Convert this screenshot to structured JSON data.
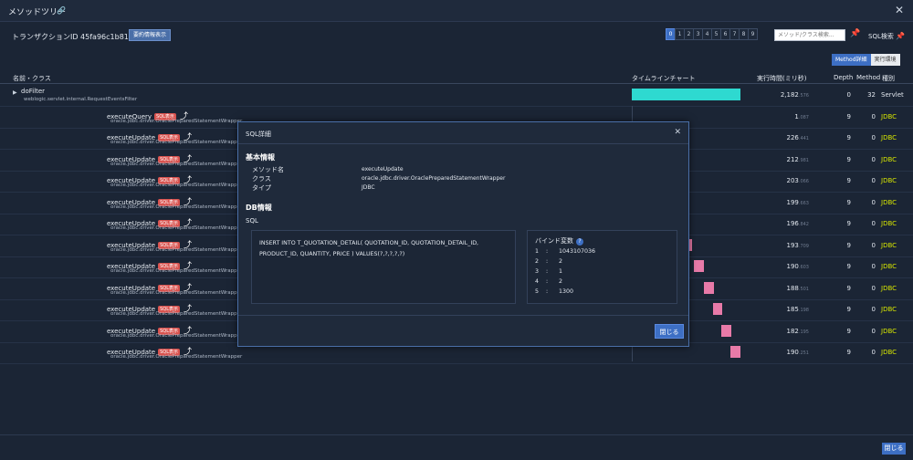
{
  "window": {
    "title": "メソッドツリー"
  },
  "transaction": {
    "label": "トランザクションID 45fa96c1b81c61ac",
    "summary_button": "要約情報表示"
  },
  "pager": [
    "0",
    "1",
    "2",
    "3",
    "4",
    "5",
    "6",
    "7",
    "8",
    "9"
  ],
  "search": {
    "placeholder": "メソッド/クラス検索..."
  },
  "sql_search_label": "SQL検索",
  "view_toggle": {
    "method_detail": "Method詳細",
    "exec_env": "実行環境"
  },
  "table": {
    "headers": {
      "name": "名前・クラス",
      "timeline": "タイムラインチャート",
      "time": "実行時間(ミリ秒)",
      "depth": "Depth",
      "method": "Method",
      "kind": "種別"
    }
  },
  "rows": [
    {
      "method": "doFilter",
      "class": "weblogic.servlet.internal.RequestEventsFilter",
      "time": "2,182",
      "time_frac": ".576",
      "depth": "0",
      "mcount": "32",
      "kind": "Servlet",
      "bar_start": 0.0,
      "bar_width": 0.55,
      "bar_color": "#2ed9d0"
    },
    {
      "method": "executeQuery",
      "badge": "SQL表示",
      "class": "oracle.jdbc.driver.OraclePreparedStatementWrapper",
      "time": "1",
      "time_frac": ".087",
      "depth": "9",
      "mcount": "0",
      "kind": "JDBC"
    },
    {
      "method": "executeUpdate",
      "badge": "SQL表示",
      "class": "oracle.jdbc.driver.OraclePreparedStatementWrapper",
      "time": "226",
      "time_frac": ".441",
      "depth": "9",
      "mcount": "0",
      "kind": "JDBC"
    },
    {
      "method": "executeUpdate",
      "badge": "SQL表示",
      "class": "oracle.jdbc.driver.OraclePreparedStatementWrapper",
      "time": "212",
      "time_frac": ".981",
      "depth": "9",
      "mcount": "0",
      "kind": "JDBC"
    },
    {
      "method": "executeUpdate",
      "badge": "SQL表示",
      "class": "oracle.jdbc.driver.OraclePreparedStatementWrapper",
      "time": "203",
      "time_frac": ".066",
      "depth": "9",
      "mcount": "0",
      "kind": "JDBC"
    },
    {
      "method": "executeUpdate",
      "badge": "SQL表示",
      "class": "oracle.jdbc.driver.OraclePreparedStatementWrapper",
      "time": "199",
      "time_frac": ".663",
      "depth": "9",
      "mcount": "0",
      "kind": "JDBC"
    },
    {
      "method": "executeUpdate",
      "badge": "SQL表示",
      "class": "oracle.jdbc.driver.OraclePreparedStatementWrapper",
      "time": "196",
      "time_frac": ".842",
      "depth": "9",
      "mcount": "0",
      "kind": "JDBC"
    },
    {
      "method": "executeUpdate",
      "badge": "SQL表示",
      "class": "oracle.jdbc.driver.OraclePreparedStatementWrapper",
      "time": "193",
      "time_frac": ".709",
      "depth": "9",
      "mcount": "0",
      "kind": "JDBC",
      "bar_start": 0.285,
      "bar_width": 0.02,
      "bar_color": "#e87aa8"
    },
    {
      "method": "executeUpdate",
      "badge": "SQL表示",
      "class": "oracle.jdbc.driver.OraclePreparedStatementWrapper",
      "time": "190",
      "time_frac": ".603",
      "depth": "9",
      "mcount": "0",
      "kind": "JDBC",
      "bar_start": 0.315,
      "bar_width": 0.05,
      "bar_color": "#e87aa8"
    },
    {
      "method": "executeUpdate",
      "badge": "SQL表示",
      "class": "oracle.jdbc.driver.OraclePreparedStatementWrapper",
      "time": "188",
      "time_frac": ".501",
      "depth": "9",
      "mcount": "0",
      "kind": "JDBC",
      "bar_start": 0.365,
      "bar_width": 0.05,
      "bar_color": "#e87aa8"
    },
    {
      "method": "executeUpdate",
      "badge": "SQL表示",
      "class": "oracle.jdbc.driver.OraclePreparedStatementWrapper",
      "time": "185",
      "time_frac": ".198",
      "depth": "9",
      "mcount": "0",
      "kind": "JDBC",
      "bar_start": 0.41,
      "bar_width": 0.05,
      "bar_color": "#e87aa8"
    },
    {
      "method": "executeUpdate",
      "badge": "SQL表示",
      "class": "oracle.jdbc.driver.OraclePreparedStatementWrapper",
      "time": "182",
      "time_frac": ".195",
      "depth": "9",
      "mcount": "0",
      "kind": "JDBC",
      "bar_start": 0.455,
      "bar_width": 0.05,
      "bar_color": "#e87aa8"
    },
    {
      "method": "executeUpdate",
      "badge": "SQL表示",
      "class": "oracle.jdbc.driver.OraclePreparedStatementWrapper",
      "time": "190",
      "time_frac": ".251",
      "depth": "9",
      "mcount": "0",
      "kind": "JDBC",
      "bar_start": 0.5,
      "bar_width": 0.05,
      "bar_color": "#e87aa8"
    }
  ],
  "modal": {
    "title": "SQL詳細",
    "basic_section": "基本情報",
    "fields": [
      {
        "key": "メソッド名",
        "value": "executeUpdate"
      },
      {
        "key": "クラス",
        "value": "oracle.jdbc.driver.OraclePreparedStatementWrapper"
      },
      {
        "key": "タイプ",
        "value": "JDBC"
      }
    ],
    "db_section": "DB情報",
    "sql_label": "SQL",
    "sql_text": "INSERT INTO T_QUOTATION_DETAIL( QUOTATION_ID, QUOTATION_DETAIL_ID, PRODUCT_ID, QUANTITY, PRICE ) VALUES(?,?,?,?,?)",
    "bind_title": "バインド変数",
    "binds": [
      {
        "index": "1",
        "sep": ":",
        "value": "1043107036"
      },
      {
        "index": "2",
        "sep": ":",
        "value": "2"
      },
      {
        "index": "3",
        "sep": ":",
        "value": "1"
      },
      {
        "index": "4",
        "sep": ":",
        "value": "2"
      },
      {
        "index": "5",
        "sep": ":",
        "value": "1300"
      }
    ],
    "close_button": "閉じる"
  },
  "footer": {
    "close_button": "閉じる"
  }
}
